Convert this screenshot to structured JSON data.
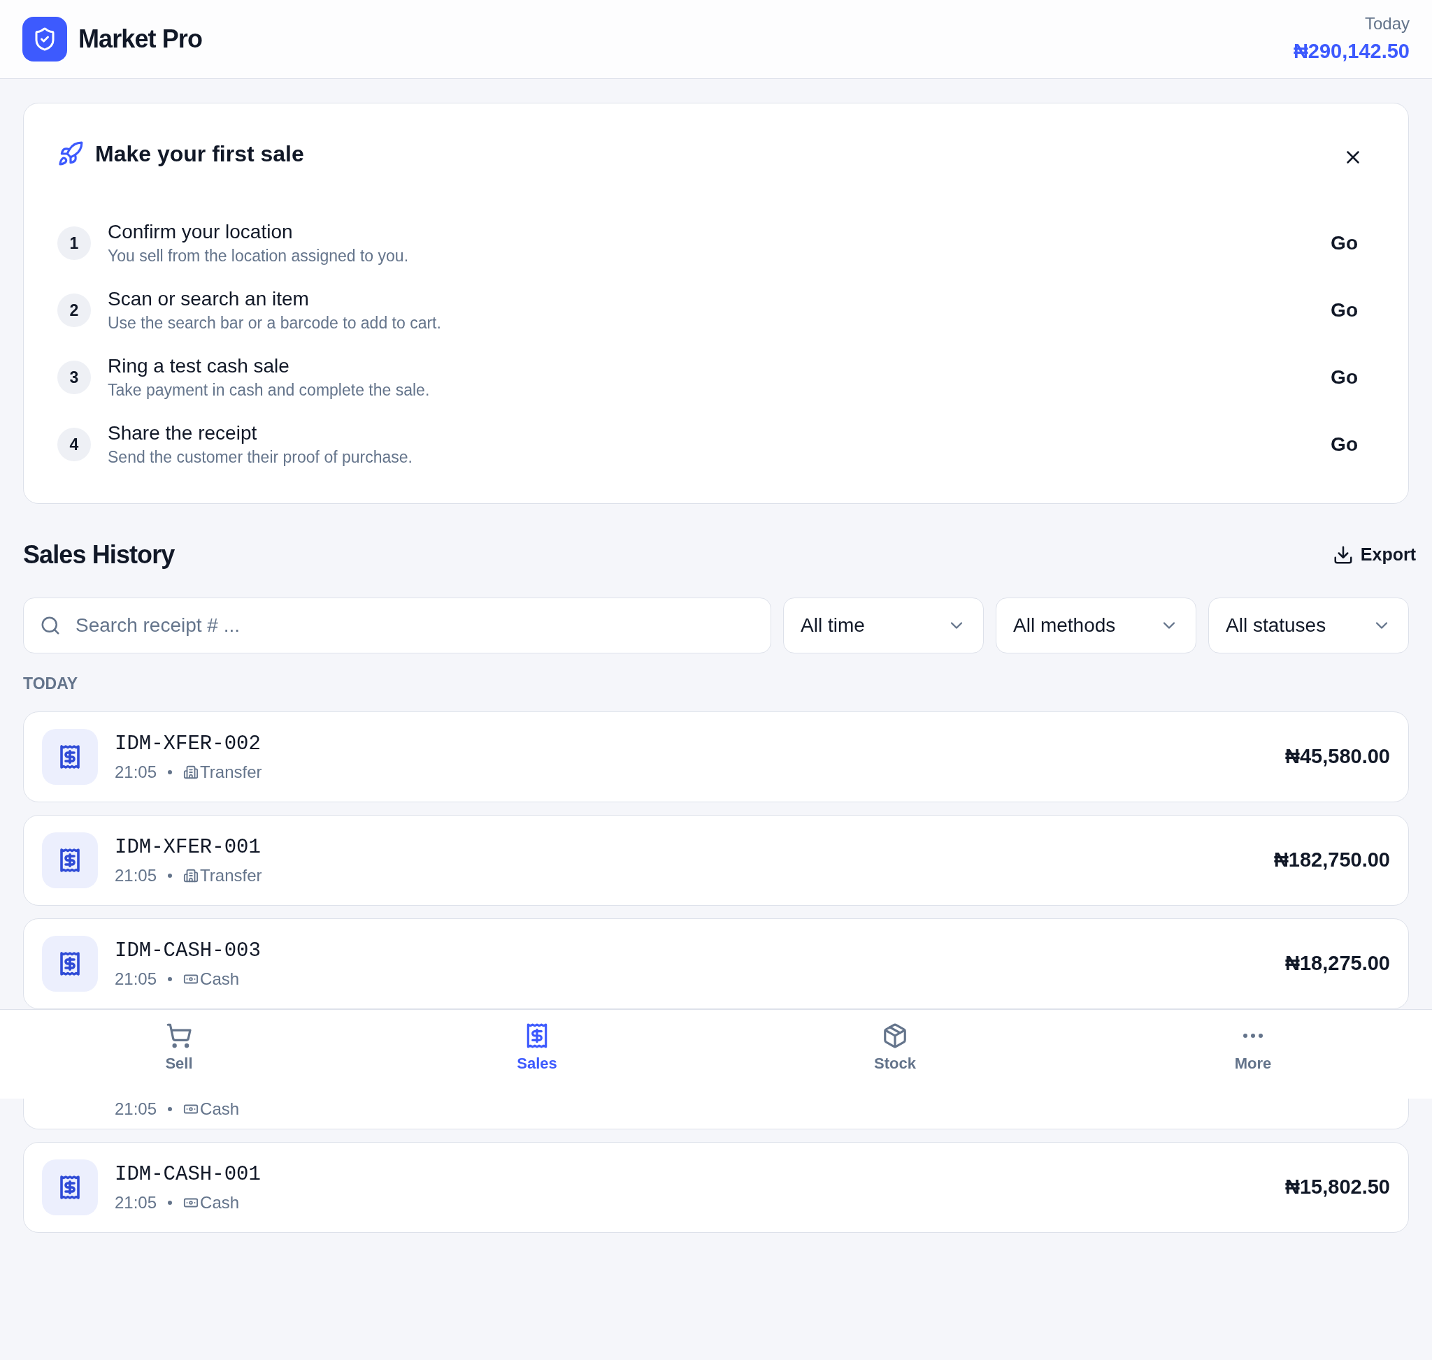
{
  "header": {
    "app_name": "Market Pro",
    "today_label": "Today",
    "today_total": "₦290,142.50"
  },
  "onboarding": {
    "title": "Make your first sale",
    "steps": [
      {
        "number": "1",
        "title": "Confirm your location",
        "description": "You sell from the location assigned to you.",
        "action": "Go"
      },
      {
        "number": "2",
        "title": "Scan or search an item",
        "description": "Use the search bar or a barcode to add to cart.",
        "action": "Go"
      },
      {
        "number": "3",
        "title": "Ring a test cash sale",
        "description": "Take payment in cash and complete the sale.",
        "action": "Go"
      },
      {
        "number": "4",
        "title": "Share the receipt",
        "description": "Send the customer their proof of purchase.",
        "action": "Go"
      }
    ]
  },
  "sales_history": {
    "title": "Sales History",
    "export": "Export",
    "search": {
      "placeholder": "Search receipt # ..."
    },
    "filters": [
      "All time",
      "All methods",
      "All statuses"
    ],
    "group_label": "TODAY",
    "rows": [
      {
        "receipt": "IDM-XFER-002",
        "time": "21:05",
        "method": "Transfer",
        "kind": "transfer",
        "amount": "₦45,580.00"
      },
      {
        "receipt": "IDM-XFER-001",
        "time": "21:05",
        "method": "Transfer",
        "kind": "transfer",
        "amount": "₦182,750.00"
      },
      {
        "receipt": "IDM-CASH-003",
        "time": "21:05",
        "method": "Cash",
        "kind": "cash",
        "amount": "₦18,275.00"
      },
      {
        "time": "21:05",
        "method": "Cash",
        "kind": "cash"
      },
      {
        "receipt": "IDM-CASH-001",
        "time": "21:05",
        "method": "Cash",
        "kind": "cash",
        "amount": "₦15,802.50"
      }
    ]
  },
  "bottom_nav": [
    {
      "label": "Sell",
      "kind": "cart",
      "selected": false
    },
    {
      "label": "Sales",
      "kind": "receipt",
      "selected": true
    },
    {
      "label": "Stock",
      "kind": "box",
      "selected": false
    },
    {
      "label": "More",
      "kind": "more",
      "selected": false
    }
  ]
}
